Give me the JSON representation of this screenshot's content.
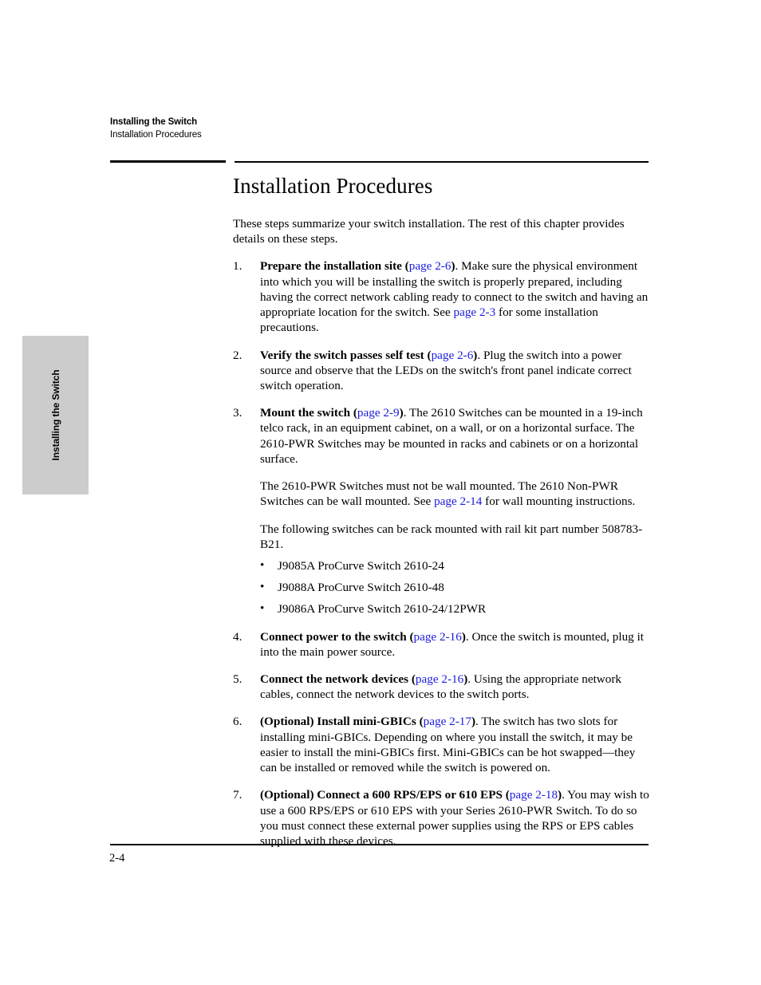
{
  "header": {
    "chapter": "Installing the Switch",
    "section": "Installation Procedures"
  },
  "side_tab": {
    "label": "Installing the Switch"
  },
  "main": {
    "title": "Installation Procedures",
    "intro": "These steps summarize your switch installation. The rest of this chapter provides details on these steps.",
    "steps": [
      {
        "number": "1.",
        "lead": "Prepare the installation site",
        "link": "page 2-6",
        "body_part1": ". Make sure the physical environment into which you will be installing the switch is properly prepared, including having the correct network cabling ready to connect to the switch and having an appropriate location for the switch. See ",
        "link2": "page 2-3",
        "body_part2": " for some installation precautions."
      },
      {
        "number": "2.",
        "lead": "Verify the switch passes self test",
        "link": "page 2-6",
        "body_part1": ". Plug the switch into a power source and observe that the LEDs on the switch's front panel indicate correct switch operation."
      },
      {
        "number": "3.",
        "lead": "Mount the switch",
        "link": "page 2-9",
        "body_part1": ". The 2610 Switches can be mounted in a 19-inch telco rack, in an equipment cabinet, on a wall, or on a horizontal surface. The 2610-PWR Switches may be mounted in racks and cabinets or on a horizontal surface."
      },
      {
        "number": "4.",
        "lead": "Connect power to the switch",
        "link": "page 2-16",
        "body_part1": ". Once the switch is mounted, plug it into the main power source."
      },
      {
        "number": "5.",
        "lead": "Connect the network devices",
        "link": "page 2-16",
        "body_part1": ". Using the appropriate network cables, connect the network devices to the switch ports."
      },
      {
        "number": "6.",
        "lead": "(Optional) Install mini-GBICs",
        "link": "page 2-17",
        "body_part1": ". The switch has two slots for installing mini-GBICs. Depending on where you install the switch, it may be easier to install the mini-GBICs first. Mini-GBICs can be hot swapped—they can be installed or removed while the switch is powered on."
      },
      {
        "number": "7.",
        "lead": "(Optional) Connect a 600 RPS/EPS or 610 EPS",
        "link": "page 2-18",
        "body_part1": ". You may wish to use a 600 RPS/EPS or 610 EPS with your Series 2610-PWR Switch. To do so you must connect these external power supplies using the RPS or EPS cables supplied with these devices."
      }
    ],
    "step3_note1_part1": "The 2610-PWR Switches must not be wall mounted. The 2610 Non-PWR Switches can be wall mounted. See ",
    "step3_note1_link": "page 2-14",
    "step3_note1_part2": " for wall mounting instructions.",
    "step3_note2": "The following switches can be rack mounted with rail kit part number 508783-B21.",
    "step3_bullets": [
      "J9085A ProCurve Switch 2610-24",
      "J9088A ProCurve Switch 2610-48",
      "J9086A ProCurve Switch 2610-24/12PWR"
    ],
    "bullet_glyph": "•"
  },
  "footer": {
    "page_number": "2-4"
  },
  "colors": {
    "link": "#1b1bdd",
    "side_tab_bg": "#cccccc",
    "text": "#000000"
  }
}
